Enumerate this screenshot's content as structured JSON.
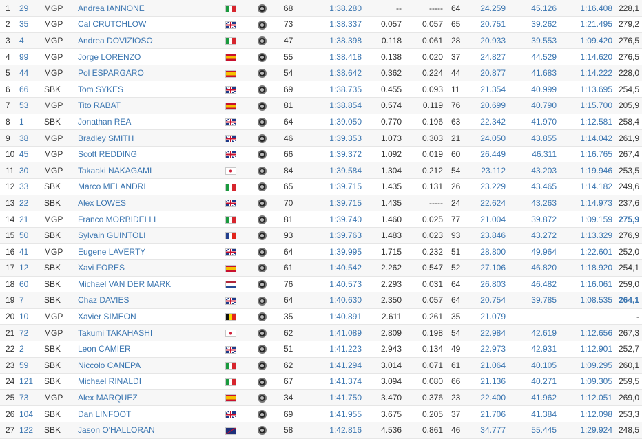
{
  "rows": [
    {
      "pos": "1",
      "num": "29",
      "cat": "MGP",
      "name": "Andrea IANNONE",
      "flag": "ITA",
      "laps": "68",
      "best": "1:38.280",
      "gap": "--",
      "prev": "-----",
      "on": "64",
      "s1": "24.259",
      "s2": "45.126",
      "s3": "1:16.408",
      "spd": "228,1",
      "top": false
    },
    {
      "pos": "2",
      "num": "35",
      "cat": "MGP",
      "name": "Cal CRUTCHLOW",
      "flag": "GBR",
      "laps": "73",
      "best": "1:38.337",
      "gap": "0.057",
      "prev": "0.057",
      "on": "65",
      "s1": "20.751",
      "s2": "39.262",
      "s3": "1:21.495",
      "spd": "279,2",
      "top": false
    },
    {
      "pos": "3",
      "num": "4",
      "cat": "MGP",
      "name": "Andrea DOVIZIOSO",
      "flag": "ITA",
      "laps": "47",
      "best": "1:38.398",
      "gap": "0.118",
      "prev": "0.061",
      "on": "28",
      "s1": "20.933",
      "s2": "39.553",
      "s3": "1:09.420",
      "spd": "276,5",
      "top": false
    },
    {
      "pos": "4",
      "num": "99",
      "cat": "MGP",
      "name": "Jorge LORENZO",
      "flag": "ESP",
      "laps": "55",
      "best": "1:38.418",
      "gap": "0.138",
      "prev": "0.020",
      "on": "37",
      "s1": "24.827",
      "s2": "44.529",
      "s3": "1:14.620",
      "spd": "276,5",
      "top": false
    },
    {
      "pos": "5",
      "num": "44",
      "cat": "MGP",
      "name": "Pol ESPARGARO",
      "flag": "ESP",
      "laps": "54",
      "best": "1:38.642",
      "gap": "0.362",
      "prev": "0.224",
      "on": "44",
      "s1": "20.877",
      "s2": "41.683",
      "s3": "1:14.222",
      "spd": "228,0",
      "top": false
    },
    {
      "pos": "6",
      "num": "66",
      "cat": "SBK",
      "name": "Tom SYKES",
      "flag": "GBR",
      "laps": "69",
      "best": "1:38.735",
      "gap": "0.455",
      "prev": "0.093",
      "on": "11",
      "s1": "21.354",
      "s2": "40.999",
      "s3": "1:13.695",
      "spd": "254,5",
      "top": false
    },
    {
      "pos": "7",
      "num": "53",
      "cat": "MGP",
      "name": "Tito RABAT",
      "flag": "ESP",
      "laps": "81",
      "best": "1:38.854",
      "gap": "0.574",
      "prev": "0.119",
      "on": "76",
      "s1": "20.699",
      "s2": "40.790",
      "s3": "1:15.700",
      "spd": "205,9",
      "top": false
    },
    {
      "pos": "8",
      "num": "1",
      "cat": "SBK",
      "name": "Jonathan REA",
      "flag": "GBR",
      "laps": "64",
      "best": "1:39.050",
      "gap": "0.770",
      "prev": "0.196",
      "on": "63",
      "s1": "22.342",
      "s2": "41.970",
      "s3": "1:12.581",
      "spd": "258,4",
      "top": false
    },
    {
      "pos": "9",
      "num": "38",
      "cat": "MGP",
      "name": "Bradley SMITH",
      "flag": "GBR",
      "laps": "46",
      "best": "1:39.353",
      "gap": "1.073",
      "prev": "0.303",
      "on": "21",
      "s1": "24.050",
      "s2": "43.855",
      "s3": "1:14.042",
      "spd": "261,9",
      "top": false
    },
    {
      "pos": "10",
      "num": "45",
      "cat": "MGP",
      "name": "Scott REDDING",
      "flag": "GBR",
      "laps": "66",
      "best": "1:39.372",
      "gap": "1.092",
      "prev": "0.019",
      "on": "60",
      "s1": "26.449",
      "s2": "46.311",
      "s3": "1:16.765",
      "spd": "267,4",
      "top": false
    },
    {
      "pos": "11",
      "num": "30",
      "cat": "MGP",
      "name": "Takaaki NAKAGAMI",
      "flag": "JPN",
      "laps": "84",
      "best": "1:39.584",
      "gap": "1.304",
      "prev": "0.212",
      "on": "54",
      "s1": "23.112",
      "s2": "43.203",
      "s3": "1:19.946",
      "spd": "253,5",
      "top": false
    },
    {
      "pos": "12",
      "num": "33",
      "cat": "SBK",
      "name": "Marco MELANDRI",
      "flag": "ITA",
      "laps": "65",
      "best": "1:39.715",
      "gap": "1.435",
      "prev": "0.131",
      "on": "26",
      "s1": "23.229",
      "s2": "43.465",
      "s3": "1:14.182",
      "spd": "249,6",
      "top": false
    },
    {
      "pos": "13",
      "num": "22",
      "cat": "SBK",
      "name": "Alex LOWES",
      "flag": "GBR",
      "laps": "70",
      "best": "1:39.715",
      "gap": "1.435",
      "prev": "-----",
      "on": "24",
      "s1": "22.624",
      "s2": "43.263",
      "s3": "1:14.973",
      "spd": "237,6",
      "top": false
    },
    {
      "pos": "14",
      "num": "21",
      "cat": "MGP",
      "name": "Franco MORBIDELLI",
      "flag": "ITA",
      "laps": "81",
      "best": "1:39.740",
      "gap": "1.460",
      "prev": "0.025",
      "on": "77",
      "s1": "21.004",
      "s2": "39.872",
      "s3": "1:09.159",
      "spd": "275,9",
      "top": true
    },
    {
      "pos": "15",
      "num": "50",
      "cat": "SBK",
      "name": "Sylvain GUINTOLI",
      "flag": "FRA",
      "laps": "93",
      "best": "1:39.763",
      "gap": "1.483",
      "prev": "0.023",
      "on": "93",
      "s1": "23.846",
      "s2": "43.272",
      "s3": "1:13.329",
      "spd": "276,9",
      "top": false
    },
    {
      "pos": "16",
      "num": "41",
      "cat": "MGP",
      "name": "Eugene LAVERTY",
      "flag": "GBR",
      "laps": "64",
      "best": "1:39.995",
      "gap": "1.715",
      "prev": "0.232",
      "on": "51",
      "s1": "28.800",
      "s2": "49.964",
      "s3": "1:22.601",
      "spd": "252,0",
      "top": false
    },
    {
      "pos": "17",
      "num": "12",
      "cat": "SBK",
      "name": "Xavi FORES",
      "flag": "ESP",
      "laps": "61",
      "best": "1:40.542",
      "gap": "2.262",
      "prev": "0.547",
      "on": "52",
      "s1": "27.106",
      "s2": "46.820",
      "s3": "1:18.920",
      "spd": "254,1",
      "top": false
    },
    {
      "pos": "18",
      "num": "60",
      "cat": "SBK",
      "name": "Michael VAN DER MARK",
      "flag": "NED",
      "laps": "76",
      "best": "1:40.573",
      "gap": "2.293",
      "prev": "0.031",
      "on": "64",
      "s1": "26.803",
      "s2": "46.482",
      "s3": "1:16.061",
      "spd": "259,0",
      "top": false
    },
    {
      "pos": "19",
      "num": "7",
      "cat": "SBK",
      "name": "Chaz DAVIES",
      "flag": "GBR",
      "laps": "64",
      "best": "1:40.630",
      "gap": "2.350",
      "prev": "0.057",
      "on": "64",
      "s1": "20.754",
      "s2": "39.785",
      "s3": "1:08.535",
      "spd": "264,1",
      "top": true
    },
    {
      "pos": "20",
      "num": "10",
      "cat": "MGP",
      "name": "Xavier SIMEON",
      "flag": "BEL",
      "laps": "35",
      "best": "1:40.891",
      "gap": "2.611",
      "prev": "0.261",
      "on": "35",
      "s1": "21.079",
      "s2": "",
      "s3": "",
      "spd": "-",
      "top": false
    },
    {
      "pos": "21",
      "num": "72",
      "cat": "MGP",
      "name": "Takumi TAKAHASHI",
      "flag": "JPN",
      "laps": "62",
      "best": "1:41.089",
      "gap": "2.809",
      "prev": "0.198",
      "on": "54",
      "s1": "22.984",
      "s2": "42.619",
      "s3": "1:12.656",
      "spd": "267,3",
      "top": false
    },
    {
      "pos": "22",
      "num": "2",
      "cat": "SBK",
      "name": "Leon CAMIER",
      "flag": "GBR",
      "laps": "51",
      "best": "1:41.223",
      "gap": "2.943",
      "prev": "0.134",
      "on": "49",
      "s1": "22.973",
      "s2": "42.931",
      "s3": "1:12.901",
      "spd": "252,7",
      "top": false
    },
    {
      "pos": "23",
      "num": "59",
      "cat": "SBK",
      "name": "Niccolo CANEPA",
      "flag": "ITA",
      "laps": "62",
      "best": "1:41.294",
      "gap": "3.014",
      "prev": "0.071",
      "on": "61",
      "s1": "21.064",
      "s2": "40.105",
      "s3": "1:09.295",
      "spd": "260,1",
      "top": false
    },
    {
      "pos": "24",
      "num": "121",
      "cat": "SBK",
      "name": "Michael RINALDI",
      "flag": "ITA",
      "laps": "67",
      "best": "1:41.374",
      "gap": "3.094",
      "prev": "0.080",
      "on": "66",
      "s1": "21.136",
      "s2": "40.271",
      "s3": "1:09.305",
      "spd": "259,5",
      "top": false
    },
    {
      "pos": "25",
      "num": "73",
      "cat": "MGP",
      "name": "Alex MARQUEZ",
      "flag": "ESP",
      "laps": "34",
      "best": "1:41.750",
      "gap": "3.470",
      "prev": "0.376",
      "on": "23",
      "s1": "22.400",
      "s2": "41.962",
      "s3": "1:12.051",
      "spd": "269,0",
      "top": false
    },
    {
      "pos": "26",
      "num": "104",
      "cat": "SBK",
      "name": "Dan LINFOOT",
      "flag": "GBR",
      "laps": "69",
      "best": "1:41.955",
      "gap": "3.675",
      "prev": "0.205",
      "on": "37",
      "s1": "21.706",
      "s2": "41.384",
      "s3": "1:12.098",
      "spd": "253,3",
      "top": false
    },
    {
      "pos": "27",
      "num": "122",
      "cat": "SBK",
      "name": "Jason O'HALLORAN",
      "flag": "AUS",
      "laps": "58",
      "best": "1:42.816",
      "gap": "4.536",
      "prev": "0.861",
      "on": "46",
      "s1": "34.777",
      "s2": "55.445",
      "s3": "1:29.924",
      "spd": "248,5",
      "top": false
    }
  ],
  "flag_styles": {
    "ITA": "linear-gradient(to right,#1a9a3e 0 33%,#ffffff 33% 66%,#d6252d 66%)",
    "ESP": "linear-gradient(to bottom,#c8102e 0 25%,#f6c100 25% 75%,#c8102e 75%)",
    "GBR": "linear-gradient(to bottom,transparent 0 40%,#c8102e 40% 60%,transparent 60%),linear-gradient(to right,transparent 0 42%,#c8102e 42% 58%,transparent 58%),linear-gradient(to bottom,transparent 0 33%,#ffffff 33% 67%,transparent 67%),linear-gradient(to right,transparent 0 36%,#ffffff 36% 64%,transparent 64%),linear-gradient(33deg,#1d3a8a 0 44%,#ffffff 44% 56%,#1d3a8a 56%)",
    "JPN": "radial-gradient(circle,#d1203a 0 25%,#ffffff 27%)",
    "FRA": "linear-gradient(to right,#23408e 0 33%,#ffffff 33% 66%,#e1251b 66%)",
    "NED": "linear-gradient(to bottom,#b0263a 0 33%,#ffffff 33% 66%,#244a94 66%)",
    "BEL": "linear-gradient(to right,#111111 0 33%,#f8d800 33% 66%,#e1251b 66%)",
    "AUS": "linear-gradient(to bottom right,#1d2f7a 0 45%,#c8102e 48% 52%,#1d2f7a 55%)"
  }
}
